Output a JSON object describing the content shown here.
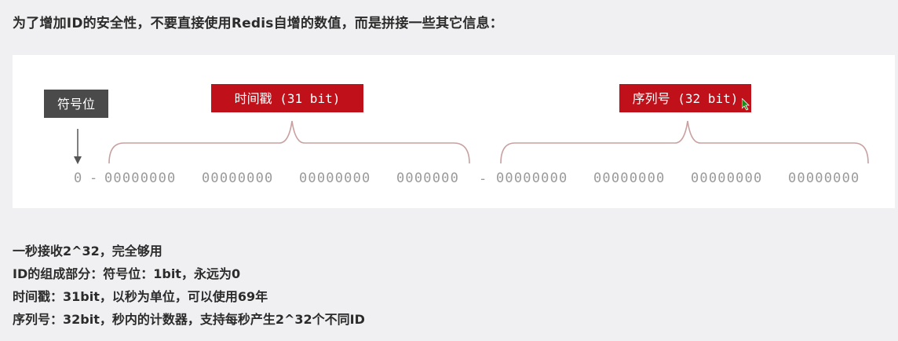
{
  "heading": "为了增加ID的安全性，不要直接使用Redis自增的数值，而是拼接一些其它信息：",
  "diagram": {
    "sign_label": "符号位",
    "timestamp_label": "时间戳 (31 bit)",
    "sequence_label": "序列号 (32 bit)",
    "sign_bit": "0",
    "separator_1": "-",
    "separator_2": "-",
    "timestamp_bits": [
      "00000000",
      "00000000",
      "00000000",
      "0000000"
    ],
    "sequence_bits": [
      "00000000",
      "00000000",
      "00000000",
      "00000000"
    ],
    "colors": {
      "label_red": "#c0101a",
      "label_gray": "#4a4a4a",
      "brace": "#c8a0a0",
      "bits": "#9a9a9a"
    }
  },
  "notes": [
    "一秒接收2^32，完全够用",
    "ID的组成部分：符号位：1bit，永远为0",
    "时间戳：31bit，以秒为单位，可以使用69年",
    "序列号：32bit，秒内的计数器，支持每秒产生2^32个不同ID"
  ]
}
